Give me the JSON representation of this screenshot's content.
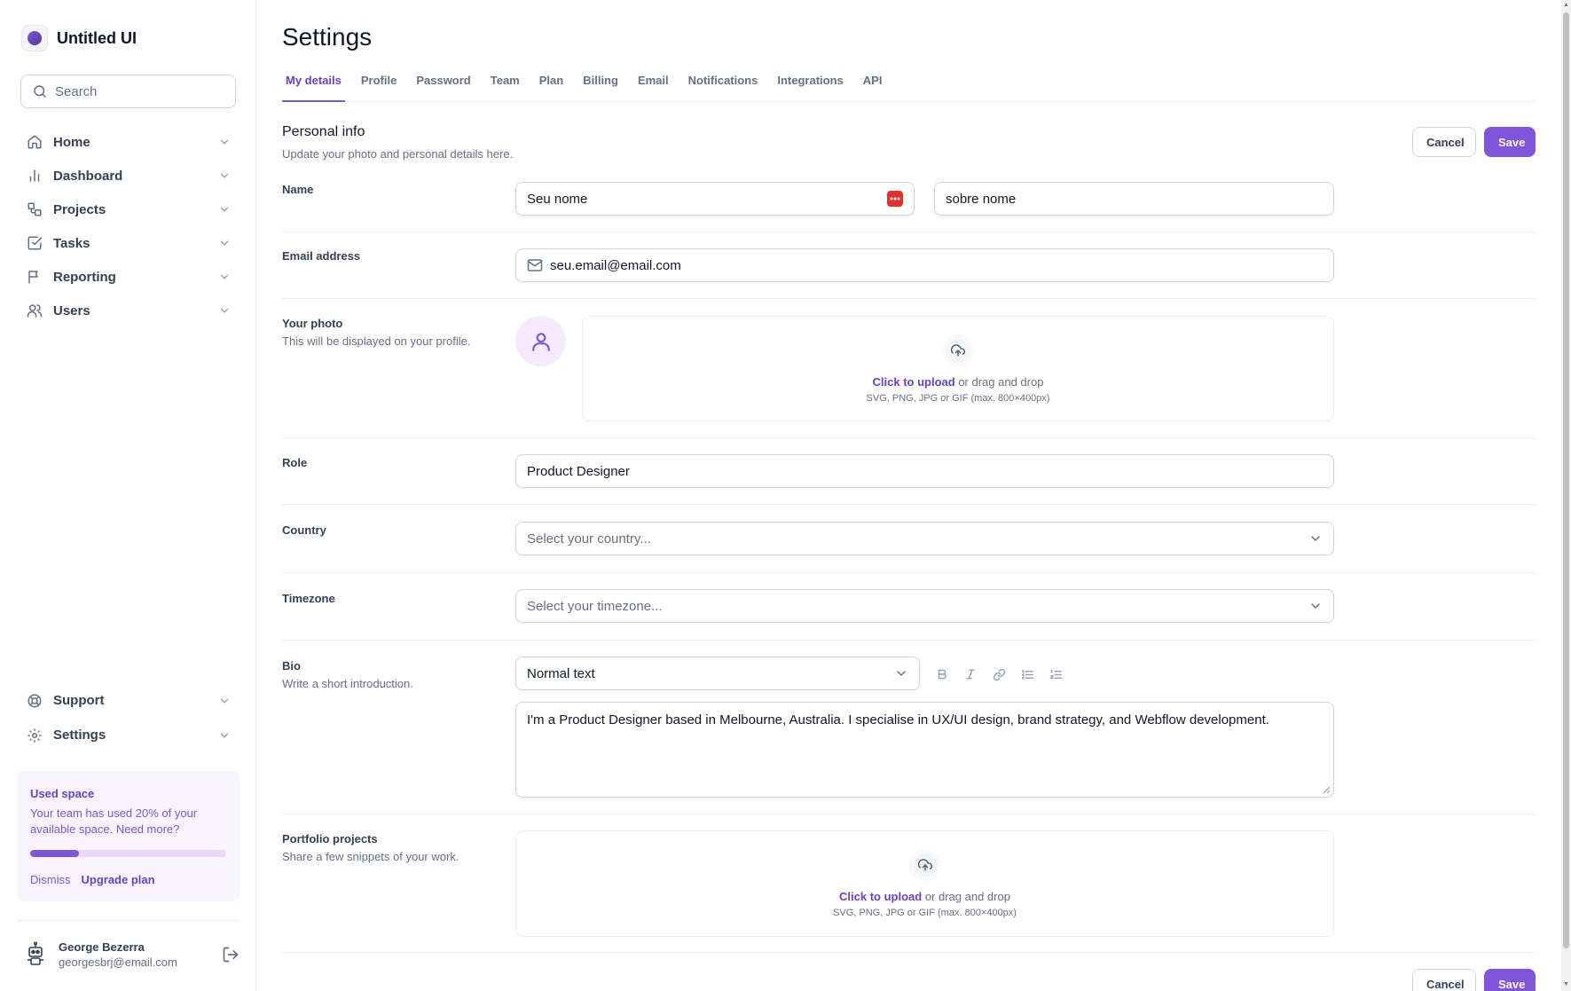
{
  "brand": {
    "name": "Untitled UI"
  },
  "search": {
    "placeholder": "Search"
  },
  "sidebar": {
    "items": [
      {
        "label": "Home",
        "icon": "home-icon"
      },
      {
        "label": "Dashboard",
        "icon": "bar-chart-icon"
      },
      {
        "label": "Projects",
        "icon": "layers-icon"
      },
      {
        "label": "Tasks",
        "icon": "check-square-icon"
      },
      {
        "label": "Reporting",
        "icon": "flag-icon"
      },
      {
        "label": "Users",
        "icon": "users-icon"
      }
    ],
    "footer_items": [
      {
        "label": "Support",
        "icon": "life-buoy-icon"
      },
      {
        "label": "Settings",
        "icon": "gear-icon"
      }
    ],
    "usage": {
      "title": "Used space",
      "description": "Your team has used 20% of your available space. Need more?",
      "percent": 0.25,
      "dismiss": "Dismiss",
      "upgrade": "Upgrade plan"
    },
    "user": {
      "name": "George Bezerra",
      "email": "georgesbrj@email.com"
    }
  },
  "page": {
    "title": "Settings"
  },
  "tabs": [
    {
      "label": "My details",
      "active": true
    },
    {
      "label": "Profile"
    },
    {
      "label": "Password"
    },
    {
      "label": "Team"
    },
    {
      "label": "Plan"
    },
    {
      "label": "Billing"
    },
    {
      "label": "Email"
    },
    {
      "label": "Notifications"
    },
    {
      "label": "Integrations"
    },
    {
      "label": "API"
    }
  ],
  "section": {
    "title": "Personal info",
    "subtitle": "Update your photo and personal details here.",
    "cancel": "Cancel",
    "save": "Save"
  },
  "form": {
    "name": {
      "label": "Name",
      "first": "Seu nome",
      "last": "sobre nome"
    },
    "email": {
      "label": "Email address",
      "value": "seu.email@email.com"
    },
    "photo": {
      "label": "Your photo",
      "help": "This will be displayed on your profile.",
      "upload_link": "Click to upload",
      "upload_text": " or drag and drop",
      "upload_hint": "SVG, PNG, JPG or GIF (max. 800×400px)"
    },
    "role": {
      "label": "Role",
      "value": "Product Designer"
    },
    "country": {
      "label": "Country",
      "placeholder": "Select your country..."
    },
    "timezone": {
      "label": "Timezone",
      "placeholder": "Select your timezone..."
    },
    "bio": {
      "label": "Bio",
      "help": "Write a short introduction.",
      "format": "Normal text",
      "value": "I'm a Product Designer based in Melbourne, Australia. I specialise in UX/UI design, brand strategy, and Webflow development."
    },
    "portfolio": {
      "label": "Portfolio projects",
      "help": "Share a few snippets of your work.",
      "upload_link": "Click to upload",
      "upload_text": " or drag and drop",
      "upload_hint": "SVG, PNG, JPG or GIF (max. 800×400px)"
    }
  },
  "colors": {
    "accent": "#7f56d9",
    "accent_dark": "#6941c6",
    "border": "#d0d5dd",
    "divider": "#eaecf0"
  }
}
